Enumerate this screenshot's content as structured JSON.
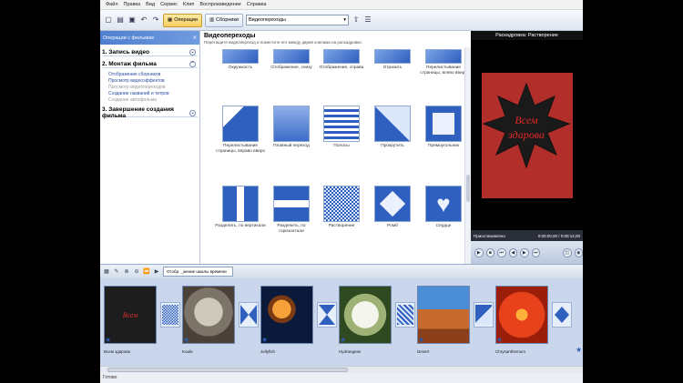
{
  "menu": [
    "Файл",
    "Правка",
    "Вид",
    "Сервис",
    "Клип",
    "Воспроизведение",
    "Справка"
  ],
  "toolbar": {
    "tasks_label": "Операции",
    "collections_label": "Сборники",
    "collection_select": "Видеопереходы"
  },
  "tasks": {
    "header": "Операции с фильмом",
    "sections": [
      {
        "title": "1. Запись видео",
        "links": []
      },
      {
        "title": "2. Монтаж фильма",
        "links": [
          {
            "label": "Отображение сборников",
            "enabled": true
          },
          {
            "label": "Просмотр видеоэффектов",
            "enabled": true
          },
          {
            "label": "Просмотр видеопереходов",
            "enabled": false
          },
          {
            "label": "Создание названий и титров",
            "enabled": true
          },
          {
            "label": "Создание автофильма",
            "enabled": false
          }
        ]
      },
      {
        "title": "3. Завершение создания фильма",
        "links": []
      }
    ]
  },
  "collection": {
    "title": "Видеопереходы",
    "description": "Перетащите видеопереход и поместите его между двумя клипами на раскадровке.",
    "items": [
      {
        "label": "Окружность"
      },
      {
        "label": "Отображение, снизу"
      },
      {
        "label": "Отображение, справа"
      },
      {
        "label": "Отразить"
      },
      {
        "label": "Перелистывание страницы, влево вверх"
      },
      {
        "label": "Перелистывание страницы, вправо вверх"
      },
      {
        "label": "Плавный переход"
      },
      {
        "label": "Полосы"
      },
      {
        "label": "Прокрутить"
      },
      {
        "label": "Прямоугольник"
      },
      {
        "label": "Разделить, по вертикали"
      },
      {
        "label": "Разделить, по горизонтали"
      },
      {
        "label": "Растворение"
      },
      {
        "label": "Ромб"
      },
      {
        "label": "Сердце"
      }
    ]
  },
  "preview": {
    "title": "Раскадровка: Растворение",
    "status": "Приостановлено",
    "time": "0:00:00,00 / 0:00:12,00",
    "slide_text_line1": "Всем",
    "slide_text_line2": "здарова"
  },
  "timeline": {
    "toggle_label": "Отобр. _жение шкалы времени"
  },
  "storyboard": {
    "clips": [
      {
        "label": "Всем здарова"
      },
      {
        "label": "Koala"
      },
      {
        "label": "Jellyfish"
      },
      {
        "label": "Hydrangeas"
      },
      {
        "label": "Desert"
      },
      {
        "label": "Chrysanthemum"
      }
    ]
  },
  "status": "Готово"
}
